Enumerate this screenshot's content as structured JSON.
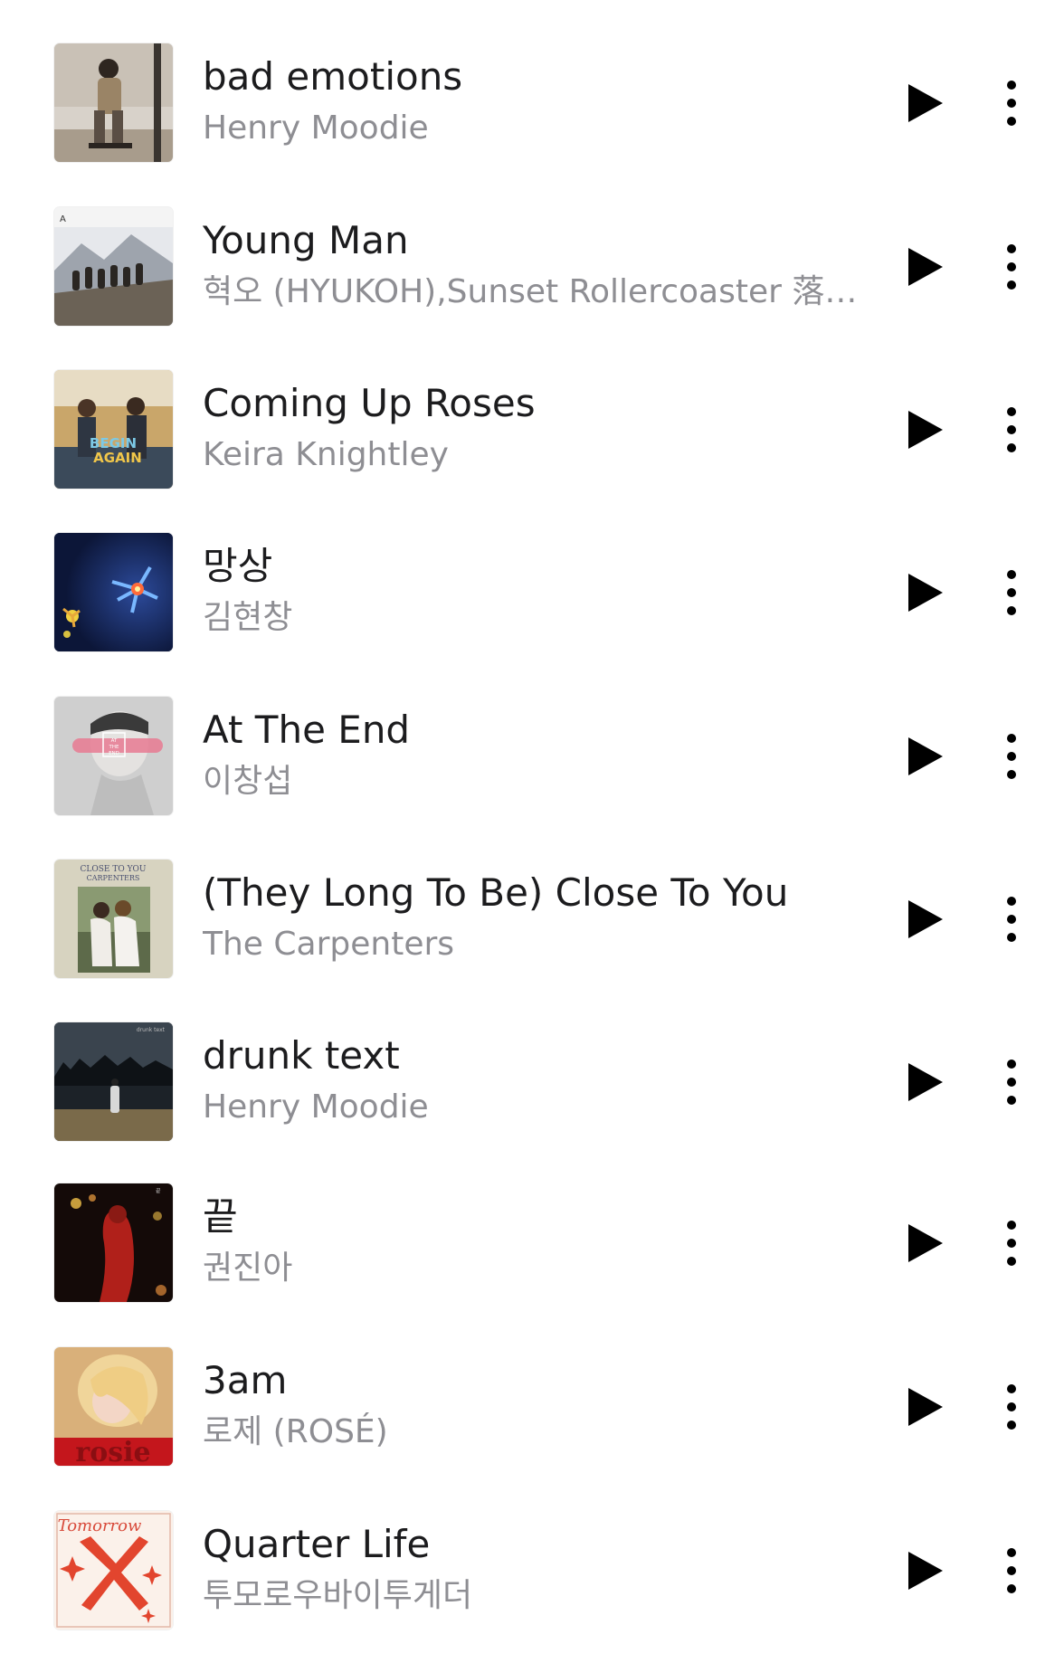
{
  "tracks": [
    {
      "title": "bad emotions",
      "artist": "Henry Moodie",
      "art": "album-art-portrait"
    },
    {
      "title": "Young Man",
      "artist": "혁오 (HYUKOH),Sunset Rollercoaster 落日飛車",
      "art": "album-art-mountain-group"
    },
    {
      "title": "Coming Up Roses",
      "artist": "Keira Knightley",
      "art": "album-art-begin-again"
    },
    {
      "title": "망상",
      "artist": "김현창",
      "art": "album-art-night-flowers"
    },
    {
      "title": "At The End",
      "artist": "이창섭",
      "art": "album-art-blindfold"
    },
    {
      "title": "(They Long To Be) Close To You",
      "artist": "The Carpenters",
      "art": "album-art-carpenters"
    },
    {
      "title": "drunk text",
      "artist": "Henry Moodie",
      "art": "album-art-dark-field"
    },
    {
      "title": "끝",
      "artist": "권진아",
      "art": "album-art-red-night"
    },
    {
      "title": "3am",
      "artist": "로제 (ROSÉ)",
      "art": "album-art-rosie"
    },
    {
      "title": "Quarter Life",
      "artist": "투모로우바이투게더",
      "art": "album-art-tomorrow-x"
    }
  ],
  "art_text": {
    "begin_again": "BEGIN AGAIN",
    "at_the_end": "AT THE END",
    "carpenters": "CLOSE TO YOU CARPENTERS",
    "rosie": "rosie",
    "tomorrow": "Tomorrow"
  },
  "icons": {
    "play": "play-icon",
    "more": "more-vertical-icon"
  },
  "colors": {
    "title": "#1c1c1e",
    "artist": "#8e8e93",
    "icon": "#000000",
    "background": "#ffffff"
  }
}
